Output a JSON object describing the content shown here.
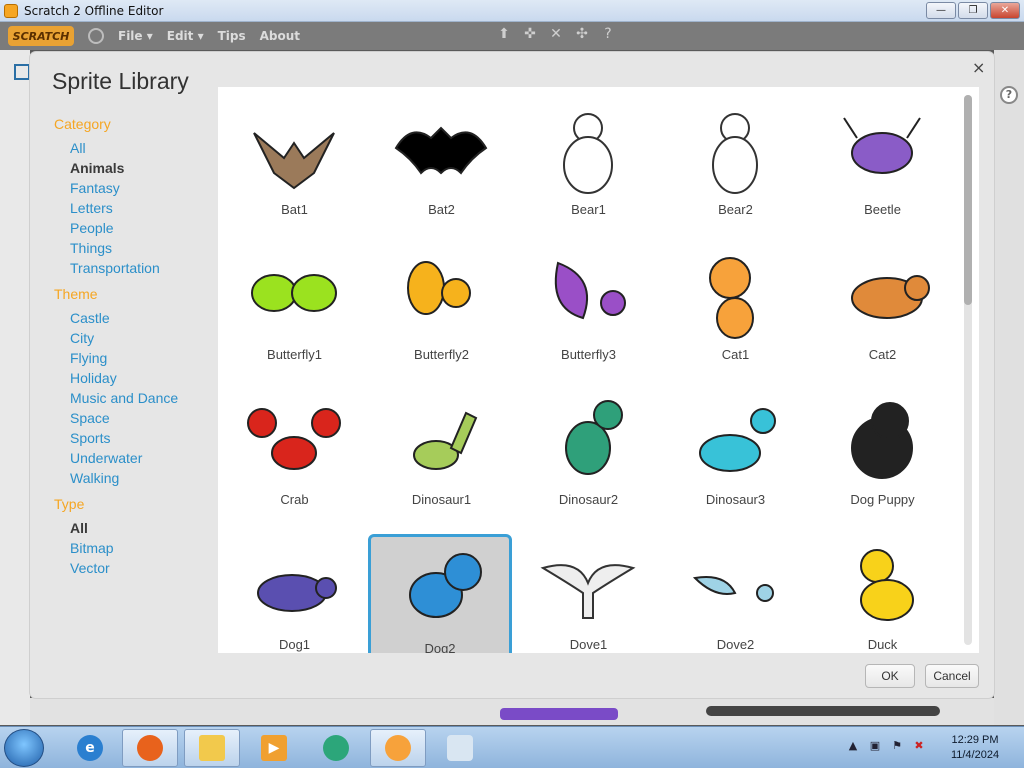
{
  "window": {
    "title": "Scratch 2 Offline Editor",
    "buttons": {
      "minimize": "—",
      "restore": "❐",
      "close": "✕"
    }
  },
  "menubar": {
    "logo": "SCRATCH",
    "items": [
      "File ▾",
      "Edit ▾",
      "Tips",
      "About"
    ],
    "tools": [
      "copy-tool-icon",
      "cut-tool-icon",
      "grow-tool-icon",
      "shrink-tool-icon",
      "help-tool-icon"
    ]
  },
  "dialog": {
    "title": "Sprite Library",
    "close": "×",
    "category_heading": "Category",
    "categories": [
      "All",
      "Animals",
      "Fantasy",
      "Letters",
      "People",
      "Things",
      "Transportation"
    ],
    "selected_category": "Animals",
    "theme_heading": "Theme",
    "themes": [
      "Castle",
      "City",
      "Flying",
      "Holiday",
      "Music and Dance",
      "Space",
      "Sports",
      "Underwater",
      "Walking"
    ],
    "type_heading": "Type",
    "types": [
      "All",
      "Bitmap",
      "Vector"
    ],
    "selected_type": "All",
    "sprites": [
      {
        "name": "Bat1",
        "icon": "bat1-icon",
        "color": "#9b7a5a"
      },
      {
        "name": "Bat2",
        "icon": "bat2-icon",
        "color": "#000000"
      },
      {
        "name": "Bear1",
        "icon": "bear1-icon",
        "color": "#ffffff"
      },
      {
        "name": "Bear2",
        "icon": "bear2-icon",
        "color": "#ffffff"
      },
      {
        "name": "Beetle",
        "icon": "beetle-icon",
        "color": "#8a5cc7"
      },
      {
        "name": "Butterfly1",
        "icon": "butterfly1-icon",
        "color": "#9be21f"
      },
      {
        "name": "Butterfly2",
        "icon": "butterfly2-icon",
        "color": "#f6b21c"
      },
      {
        "name": "Butterfly3",
        "icon": "butterfly3-icon",
        "color": "#9a4fc7"
      },
      {
        "name": "Cat1",
        "icon": "cat1-icon",
        "color": "#f7a23b"
      },
      {
        "name": "Cat2",
        "icon": "cat2-icon",
        "color": "#e08a3a"
      },
      {
        "name": "Crab",
        "icon": "crab-icon",
        "color": "#d9251c"
      },
      {
        "name": "Dinosaur1",
        "icon": "dinosaur1-icon",
        "color": "#a6cc5a"
      },
      {
        "name": "Dinosaur2",
        "icon": "dinosaur2-icon",
        "color": "#2fa07a"
      },
      {
        "name": "Dinosaur3",
        "icon": "dinosaur3-icon",
        "color": "#38c2d8"
      },
      {
        "name": "Dog Puppy",
        "icon": "dog-puppy-icon",
        "color": "#222222"
      },
      {
        "name": "Dog1",
        "icon": "dog1-icon",
        "color": "#5a4fb0"
      },
      {
        "name": "Dog2",
        "icon": "dog2-icon",
        "color": "#2e8fd6"
      },
      {
        "name": "Dove1",
        "icon": "dove1-icon",
        "color": "#eeeeee"
      },
      {
        "name": "Dove2",
        "icon": "dove2-icon",
        "color": "#9fd3e6"
      },
      {
        "name": "Duck",
        "icon": "duck-icon",
        "color": "#f8d21a"
      }
    ],
    "selected_sprite": "Dog2",
    "ok_label": "OK",
    "cancel_label": "Cancel"
  },
  "taskbar": {
    "apps": [
      "internet-explorer-icon",
      "firefox-icon",
      "file-explorer-icon",
      "media-player-icon",
      "app-icon",
      "scratch-icon",
      "paint-icon"
    ],
    "active_app": "scratch-icon",
    "time": "12:29 PM",
    "date": "11/4/2024"
  },
  "colors": {
    "accent_orange": "#f5a623",
    "link_blue": "#2b8fc9",
    "selection_blue": "#3a9fd6"
  }
}
